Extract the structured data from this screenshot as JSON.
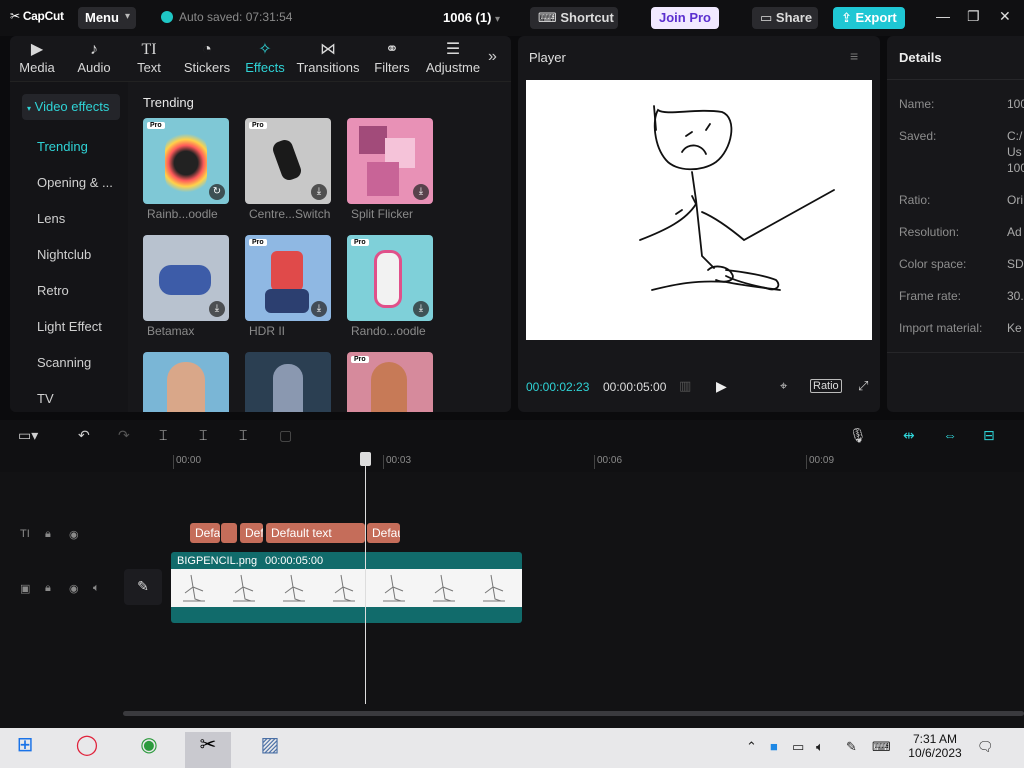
{
  "titlebar": {
    "logo": "CapCut",
    "menu_label": "Menu",
    "autosave": "Auto saved: 07:31:54",
    "project_name": "1006 (1)",
    "shortcut_label": "Shortcut",
    "join_pro_label": "Join Pro",
    "share_label": "Share",
    "export_label": "Export"
  },
  "tabs": [
    {
      "label": "Media",
      "icon": "media-icon"
    },
    {
      "label": "Audio",
      "icon": "audio-icon"
    },
    {
      "label": "Text",
      "icon": "text-icon"
    },
    {
      "label": "Stickers",
      "icon": "stickers-icon"
    },
    {
      "label": "Effects",
      "icon": "effects-icon",
      "active": true
    },
    {
      "label": "Transitions",
      "icon": "transitions-icon"
    },
    {
      "label": "Filters",
      "icon": "filters-icon"
    },
    {
      "label": "Adjustme",
      "icon": "adjustment-icon"
    }
  ],
  "sidebar": {
    "header": "Video effects",
    "items": [
      "Trending",
      "Opening & ...",
      "Lens",
      "Nightclub",
      "Retro",
      "Light Effect",
      "Scanning",
      "TV"
    ]
  },
  "effects": {
    "section_title": "Trending",
    "pro_badge": "Pro",
    "items": [
      {
        "label": "Rainb...oodle",
        "pro": true,
        "color": "#7fc8d6"
      },
      {
        "label": "Centre...Switch",
        "pro": true,
        "color": "#c8c8c8"
      },
      {
        "label": "Split Flicker",
        "pro": false,
        "color": "#e891b6"
      },
      {
        "label": "Betamax",
        "pro": false,
        "color": "#b8c2cf"
      },
      {
        "label": "HDR II",
        "pro": true,
        "color": "#8fb8e3"
      },
      {
        "label": "Rando...oodle",
        "pro": true,
        "color": "#7fd0d9"
      },
      {
        "label": "",
        "pro": false,
        "color": "#7ab6d6"
      },
      {
        "label": "",
        "pro": false,
        "color": "#2b3f52"
      },
      {
        "label": "",
        "pro": true,
        "color": "#d68a9c"
      }
    ]
  },
  "player": {
    "title": "Player",
    "current_time": "00:00:02:23",
    "total_time": "00:00:05:00",
    "ratio_label": "Ratio"
  },
  "details": {
    "title": "Details",
    "rows": [
      {
        "label": "Name:",
        "value": "100"
      },
      {
        "label": "Saved:",
        "value": "C:/"
      },
      {
        "label": "Ratio:",
        "value": "Ori"
      },
      {
        "label": "Resolution:",
        "value": "Ad"
      },
      {
        "label": "Color space:",
        "value": "SD"
      },
      {
        "label": "Frame rate:",
        "value": "30."
      },
      {
        "label": "Import material:",
        "value": "Ke"
      }
    ],
    "saved_extra": [
      "Us",
      "100"
    ]
  },
  "timeline": {
    "ruler": [
      "00:00",
      "00:03",
      "00:06",
      "00:09"
    ],
    "text_clips": [
      "Defa",
      "",
      "Def",
      "Default text",
      "Defau"
    ],
    "video_clip": {
      "name": "BIGPENCIL.png",
      "duration": "00:00:05:00"
    }
  },
  "taskbar": {
    "time": "7:31 AM",
    "date": "10/6/2023"
  },
  "colors": {
    "accent": "#2fd3d6",
    "export": "#1fc7d4",
    "text_clip": "#c56d5a",
    "video_clip": "#116b6b"
  }
}
